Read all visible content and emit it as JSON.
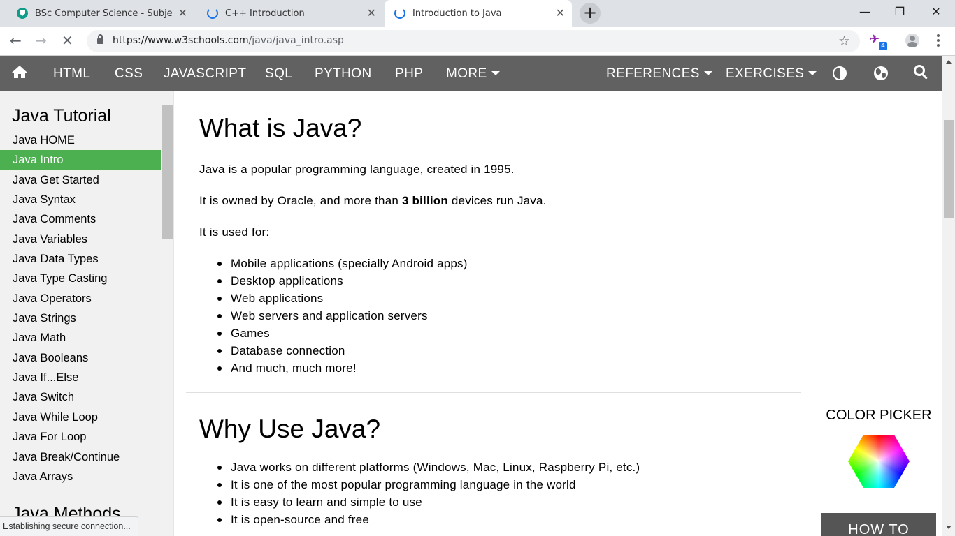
{
  "browser": {
    "tabs": [
      {
        "title": "BSc Computer Science - Subjects",
        "close": "✕"
      },
      {
        "title": "C++ Introduction",
        "close": "✕"
      },
      {
        "title": "Introduction to Java",
        "close": "✕"
      }
    ],
    "new_tab": "+",
    "window_controls": {
      "minimize": "—",
      "maximize": "❐",
      "close": "✕"
    },
    "nav": {
      "back": "←",
      "forward": "→",
      "stop": "✕"
    },
    "url": {
      "host": "https://www.w3schools.com",
      "path": "/java/java_intro.asp"
    },
    "extension_badge": "4"
  },
  "topnav": {
    "items": [
      "HTML",
      "CSS",
      "JAVASCRIPT",
      "SQL",
      "PYTHON",
      "PHP",
      "MORE"
    ],
    "references": "REFERENCES",
    "exercises": "EXERCISES"
  },
  "sidebar": {
    "title": "Java Tutorial",
    "items": [
      "Java HOME",
      "Java Intro",
      "Java Get Started",
      "Java Syntax",
      "Java Comments",
      "Java Variables",
      "Java Data Types",
      "Java Type Casting",
      "Java Operators",
      "Java Strings",
      "Java Math",
      "Java Booleans",
      "Java If...Else",
      "Java Switch",
      "Java While Loop",
      "Java For Loop",
      "Java Break/Continue",
      "Java Arrays"
    ],
    "active_index": 1,
    "section2_title": "Java Methods"
  },
  "main": {
    "heading1": "What is Java?",
    "p1": "Java is a popular programming language, created in 1995.",
    "p2_before": "It is owned by Oracle, and more than ",
    "p2_bold": "3 billion",
    "p2_after": " devices run Java.",
    "p3": "It is used for:",
    "uses": [
      "Mobile applications (specially Android apps)",
      "Desktop applications",
      "Web applications",
      "Web servers and application servers",
      "Games",
      "Database connection",
      "And much, much more!"
    ],
    "heading2": "Why Use Java?",
    "reasons": [
      "Java works on different platforms (Windows, Mac, Linux, Raspberry Pi, etc.)",
      "It is one of the most popular programming language in the world",
      "It is easy to learn and simple to use",
      "It is open-source and free"
    ]
  },
  "rightcol": {
    "color_picker_title": "COLOR PICKER",
    "howto": "HOW TO"
  },
  "status": {
    "text": "Establishing secure connection..."
  },
  "colors": {
    "nav_bg": "#616161",
    "active_green": "#4caf50",
    "sidebar_bg": "#f1f1f1"
  }
}
